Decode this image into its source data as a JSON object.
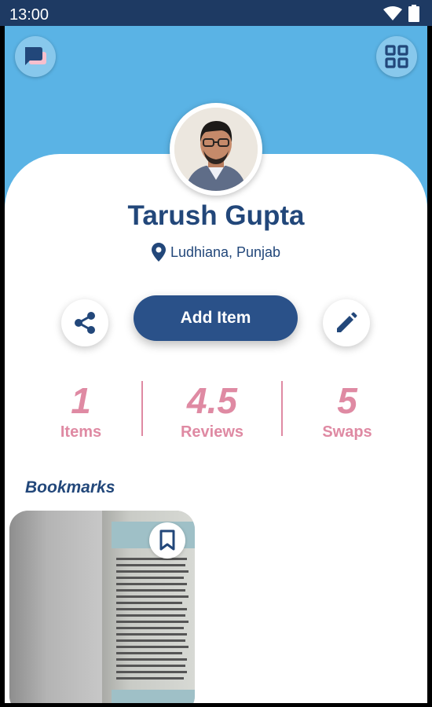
{
  "status_bar": {
    "time": "13:00"
  },
  "profile": {
    "name": "Tarush Gupta",
    "location": "Ludhiana, Punjab"
  },
  "actions": {
    "add_item_label": "Add Item",
    "share_icon": "share-icon",
    "edit_icon": "pencil-icon"
  },
  "stats": [
    {
      "value": "1",
      "label": "Items"
    },
    {
      "value": "4.5",
      "label": "Reviews"
    },
    {
      "value": "5",
      "label": "Swaps"
    }
  ],
  "bookmarks": {
    "title": "Bookmarks"
  },
  "colors": {
    "header_bg": "#5ab3e5",
    "primary": "#2a5189",
    "text_primary": "#22477a",
    "stat_pink": "#df8aa3",
    "status_bar": "#1e3a63"
  }
}
